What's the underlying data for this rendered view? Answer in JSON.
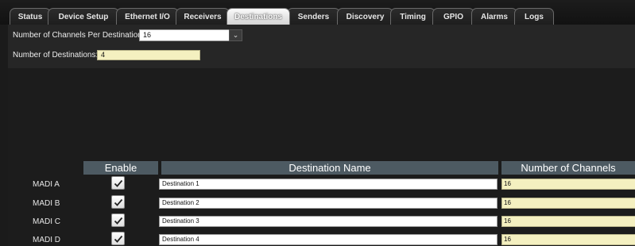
{
  "tabs": [
    {
      "label": "Status",
      "active": false
    },
    {
      "label": "Device Setup",
      "active": false
    },
    {
      "label": "Ethernet I/O",
      "active": false
    },
    {
      "label": "Receivers",
      "active": false
    },
    {
      "label": "Destinations",
      "active": true
    },
    {
      "label": "Senders",
      "active": false
    },
    {
      "label": "Discovery",
      "active": false
    },
    {
      "label": "Timing",
      "active": false
    },
    {
      "label": "GPIO",
      "active": false
    },
    {
      "label": "Alarms",
      "active": false
    },
    {
      "label": "Logs",
      "active": false
    }
  ],
  "settings": {
    "channels_per_destination_label": "Number of Channels Per Destination",
    "channels_per_destination_value": "16",
    "num_destinations_label": "Number of Destinations:",
    "num_destinations_value": "4"
  },
  "table": {
    "headers": {
      "enable": "Enable",
      "name": "Destination Name",
      "channels": "Number of Channels"
    },
    "rows": [
      {
        "label": "MADI A",
        "enabled": true,
        "name": "Destination 1",
        "channels": "16"
      },
      {
        "label": "MADI B",
        "enabled": true,
        "name": "Destination 2",
        "channels": "16"
      },
      {
        "label": "MADI C",
        "enabled": true,
        "name": "Destination 3",
        "channels": "16"
      },
      {
        "label": "MADI D",
        "enabled": true,
        "name": "Destination 4",
        "channels": "16"
      }
    ]
  },
  "colors": {
    "header_bg": "#4d5a62",
    "numeric_field_bg": "#f4f0c0",
    "panel_bg": "#1c1c1c"
  }
}
